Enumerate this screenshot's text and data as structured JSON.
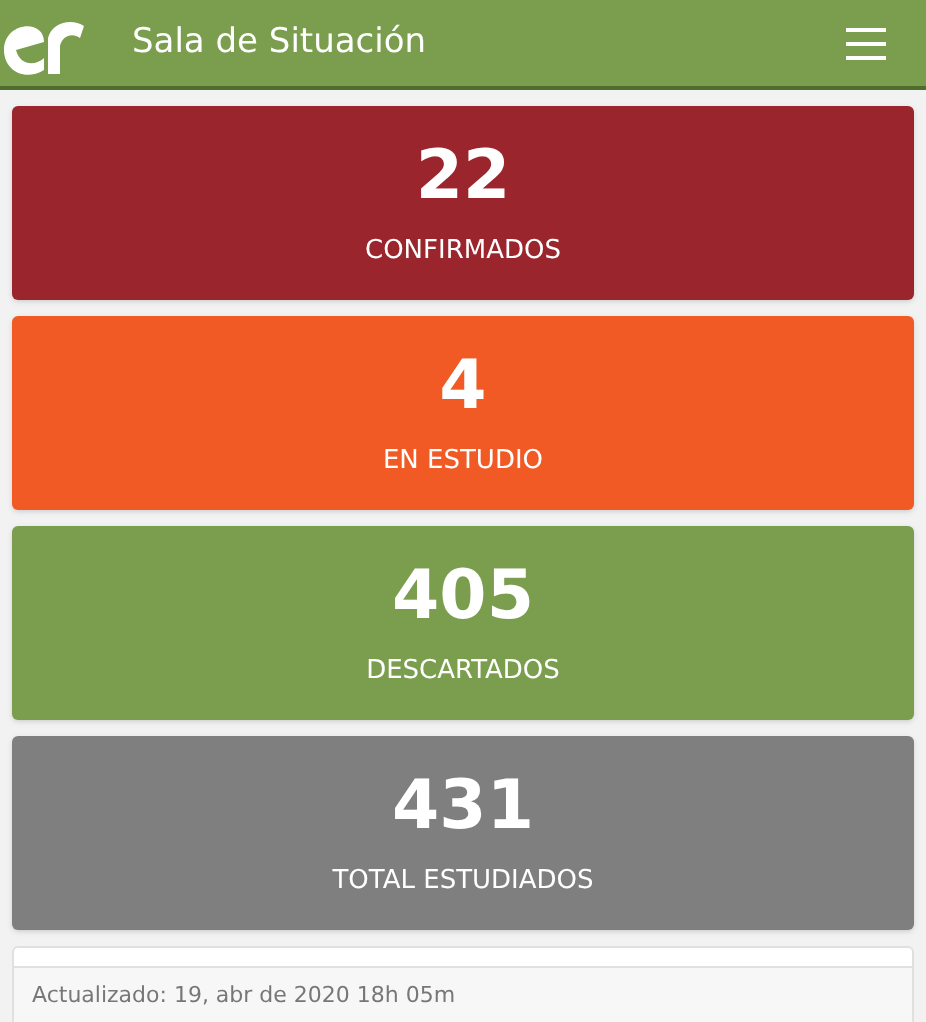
{
  "header": {
    "title": "Sala de Situación"
  },
  "stats": [
    {
      "value": "22",
      "label": "CONFIRMADOS",
      "color": "#9b252d"
    },
    {
      "value": "4",
      "label": "EN ESTUDIO",
      "color": "#f15a24"
    },
    {
      "value": "405",
      "label": "DESCARTADOS",
      "color": "#7a9e4e"
    },
    {
      "value": "431",
      "label": "TOTAL ESTUDIADOS",
      "color": "#7f7f7f"
    }
  ],
  "footer": {
    "updated": "Actualizado: 19, abr de 2020 18h 05m"
  }
}
